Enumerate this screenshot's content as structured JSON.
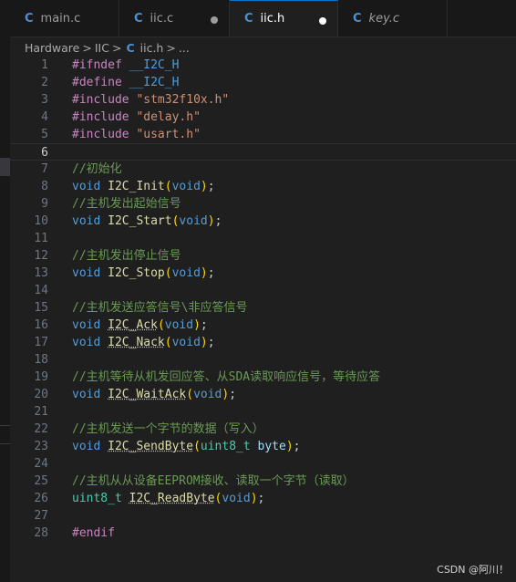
{
  "tabs": [
    {
      "icon": "C",
      "label": "main.c",
      "modified": false,
      "active": false,
      "italic": false
    },
    {
      "icon": "C",
      "label": "iic.c",
      "modified": true,
      "active": false,
      "italic": false
    },
    {
      "icon": "C",
      "label": "iic.h",
      "modified": true,
      "active": true,
      "italic": false
    },
    {
      "icon": "C",
      "label": "key.c",
      "modified": false,
      "active": false,
      "italic": true
    }
  ],
  "breadcrumb": {
    "folder1": "Hardware",
    "folder2": "IIC",
    "file_icon": "C",
    "file": "iic.h",
    "ellipsis": "...",
    "separator": ">"
  },
  "current_line": 6,
  "code_lines": [
    {
      "n": "1",
      "tokens": [
        [
          "pp",
          "#ifndef"
        ],
        [
          "pl",
          " "
        ],
        [
          "mac",
          "__I2C_H"
        ]
      ]
    },
    {
      "n": "2",
      "tokens": [
        [
          "pp",
          "#define"
        ],
        [
          "pl",
          " "
        ],
        [
          "mac",
          "__I2C_H"
        ]
      ]
    },
    {
      "n": "3",
      "tokens": [
        [
          "pp",
          "#include"
        ],
        [
          "pl",
          " "
        ],
        [
          "str",
          "\"stm32f10x.h\""
        ]
      ]
    },
    {
      "n": "4",
      "tokens": [
        [
          "pp",
          "#include"
        ],
        [
          "pl",
          " "
        ],
        [
          "str",
          "\"delay.h\""
        ]
      ]
    },
    {
      "n": "5",
      "tokens": [
        [
          "pp",
          "#include"
        ],
        [
          "pl",
          " "
        ],
        [
          "str",
          "\"usart.h\""
        ]
      ]
    },
    {
      "n": "6",
      "tokens": []
    },
    {
      "n": "7",
      "tokens": [
        [
          "com",
          "//初始化"
        ]
      ]
    },
    {
      "n": "8",
      "tokens": [
        [
          "kw",
          "void"
        ],
        [
          "pl",
          " "
        ],
        [
          "fn",
          "I2C_Init"
        ],
        [
          "par",
          "("
        ],
        [
          "kw",
          "void"
        ],
        [
          "par",
          ")"
        ],
        [
          "pl",
          ";"
        ]
      ]
    },
    {
      "n": "9",
      "tokens": [
        [
          "com",
          "//主机发出起始信号"
        ]
      ]
    },
    {
      "n": "10",
      "tokens": [
        [
          "kw",
          "void"
        ],
        [
          "pl",
          " "
        ],
        [
          "fn",
          "I2C_Start"
        ],
        [
          "par",
          "("
        ],
        [
          "kw",
          "void"
        ],
        [
          "par",
          ")"
        ],
        [
          "pl",
          ";"
        ]
      ]
    },
    {
      "n": "11",
      "tokens": []
    },
    {
      "n": "12",
      "tokens": [
        [
          "com",
          "//主机发出停止信号"
        ]
      ]
    },
    {
      "n": "13",
      "tokens": [
        [
          "kw",
          "void"
        ],
        [
          "pl",
          " "
        ],
        [
          "fn",
          "I2C_Stop"
        ],
        [
          "par",
          "("
        ],
        [
          "kw",
          "void"
        ],
        [
          "par",
          ")"
        ],
        [
          "pl",
          ";"
        ]
      ]
    },
    {
      "n": "14",
      "tokens": []
    },
    {
      "n": "15",
      "tokens": [
        [
          "com",
          "//主机发送应答信号\\非应答信号"
        ]
      ]
    },
    {
      "n": "16",
      "tokens": [
        [
          "kw",
          "void"
        ],
        [
          "pl",
          " "
        ],
        [
          "fnsq",
          "I2C_Ack"
        ],
        [
          "par",
          "("
        ],
        [
          "kw",
          "void"
        ],
        [
          "par",
          ")"
        ],
        [
          "pl",
          ";"
        ]
      ]
    },
    {
      "n": "17",
      "tokens": [
        [
          "kw",
          "void"
        ],
        [
          "pl",
          " "
        ],
        [
          "fnsq",
          "I2C_Nack"
        ],
        [
          "par",
          "("
        ],
        [
          "kw",
          "void"
        ],
        [
          "par",
          ")"
        ],
        [
          "pl",
          ";"
        ]
      ]
    },
    {
      "n": "18",
      "tokens": []
    },
    {
      "n": "19",
      "tokens": [
        [
          "com",
          "//主机等待从机发回应答、从SDA读取响应信号，等待应答"
        ]
      ]
    },
    {
      "n": "20",
      "tokens": [
        [
          "kw",
          "void"
        ],
        [
          "pl",
          " "
        ],
        [
          "fnsq",
          "I2C_WaitAck"
        ],
        [
          "par",
          "("
        ],
        [
          "kw",
          "void"
        ],
        [
          "par",
          ")"
        ],
        [
          "pl",
          ";"
        ]
      ]
    },
    {
      "n": "21",
      "tokens": []
    },
    {
      "n": "22",
      "tokens": [
        [
          "com",
          "//主机发送一个字节的数据（写入）"
        ]
      ]
    },
    {
      "n": "23",
      "tokens": [
        [
          "kw",
          "void"
        ],
        [
          "pl",
          " "
        ],
        [
          "fnsq",
          "I2C_SendByte"
        ],
        [
          "par",
          "("
        ],
        [
          "ty",
          "uint8_t"
        ],
        [
          "pl",
          " "
        ],
        [
          "var",
          "byte"
        ],
        [
          "par",
          ")"
        ],
        [
          "pl",
          ";"
        ]
      ]
    },
    {
      "n": "24",
      "tokens": []
    },
    {
      "n": "25",
      "tokens": [
        [
          "com",
          "//主机从从设备EEPROM接收、读取一个字节（读取）"
        ]
      ]
    },
    {
      "n": "26",
      "tokens": [
        [
          "ty",
          "uint8_t"
        ],
        [
          "pl",
          " "
        ],
        [
          "fnsq",
          "I2C_ReadByte"
        ],
        [
          "par",
          "("
        ],
        [
          "kw",
          "void"
        ],
        [
          "par",
          ")"
        ],
        [
          "pl",
          ";"
        ]
      ]
    },
    {
      "n": "27",
      "tokens": []
    },
    {
      "n": "28",
      "tokens": [
        [
          "pp",
          "#endif"
        ]
      ]
    }
  ],
  "watermark": "CSDN @阿川！",
  "colors": {
    "background": "#1f1f1f",
    "tab_bar": "#181818",
    "accent": "#0078d4",
    "c_icon": "#4d8fd6",
    "preprocessor": "#c586c0",
    "keyword": "#569cd6",
    "string": "#ce9178",
    "comment": "#6a9955",
    "function": "#dcdcaa",
    "type": "#4ec9b0",
    "bracket": "#ffd700"
  }
}
